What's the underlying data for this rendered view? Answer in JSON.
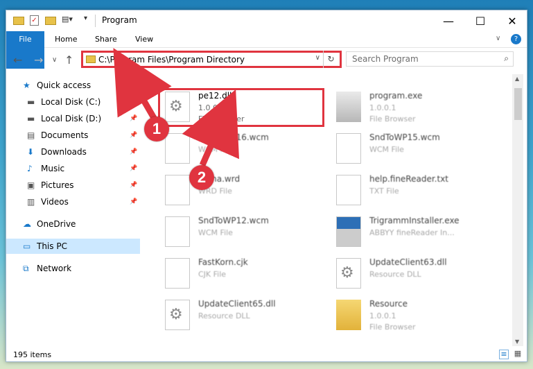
{
  "window": {
    "title": "Program"
  },
  "ribbon": {
    "tabs": [
      "File",
      "Home",
      "Share",
      "View"
    ]
  },
  "address": {
    "path": "C:\\Program Files\\Program Directory"
  },
  "search": {
    "placeholder": "Search Program"
  },
  "sidebar": {
    "items": [
      {
        "label": "Quick access",
        "icon": "star-icon"
      },
      {
        "label": "Local Disk (C:)",
        "icon": "drive-icon",
        "pinned": true
      },
      {
        "label": "Local Disk (D:)",
        "icon": "drive-icon",
        "pinned": true
      },
      {
        "label": "Documents",
        "icon": "documents-icon",
        "pinned": true
      },
      {
        "label": "Downloads",
        "icon": "downloads-icon",
        "pinned": true
      },
      {
        "label": "Music",
        "icon": "music-icon",
        "pinned": true
      },
      {
        "label": "Pictures",
        "icon": "pictures-icon",
        "pinned": true
      },
      {
        "label": "Videos",
        "icon": "videos-icon",
        "pinned": true
      },
      {
        "label": "OneDrive",
        "icon": "cloud-icon"
      },
      {
        "label": "This PC",
        "icon": "computer-icon",
        "selected": true
      },
      {
        "label": "Network",
        "icon": "network-icon"
      }
    ]
  },
  "files": [
    {
      "name": "pe12.dll",
      "version": "1.0.0.1",
      "type": "File Browser",
      "icon": "gear-file-icon"
    },
    {
      "name": "program.exe",
      "version": "1.0.0.1",
      "type": "File Browser",
      "icon": "exe-icon"
    },
    {
      "name": "SndToWP16.wcm",
      "version": "",
      "type": "WCM File",
      "icon": "file-icon"
    },
    {
      "name": "SndToWP15.wcm",
      "version": "",
      "type": "WCM File",
      "icon": "file-icon"
    },
    {
      "name": "Alpha.wrd",
      "version": "",
      "type": "WRD File",
      "icon": "file-icon"
    },
    {
      "name": "help.fineReader.txt",
      "version": "",
      "type": "TXT File",
      "icon": "file-icon"
    },
    {
      "name": "SndToWP12.wcm",
      "version": "",
      "type": "WCM File",
      "icon": "file-icon"
    },
    {
      "name": "TrigrammInstaller.exe",
      "version": "",
      "type": "ABBYY fineReader In...",
      "icon": "installer-icon"
    },
    {
      "name": "FastKorn.cjk",
      "version": "",
      "type": "CJK File",
      "icon": "file-icon"
    },
    {
      "name": "UpdateClient63.dll",
      "version": "",
      "type": "Resource DLL",
      "icon": "gear-file-icon"
    },
    {
      "name": "UpdateClient65.dll",
      "version": "",
      "type": "Resource DLL",
      "icon": "gear-file-icon"
    },
    {
      "name": "Resource",
      "version": "1.0.0.1",
      "type": "File Browser",
      "icon": "folder-zip-icon"
    }
  ],
  "status": {
    "count": "195 items"
  },
  "callouts": [
    "1",
    "2"
  ],
  "colors": {
    "accent": "#1979ca",
    "highlight": "#e0343f"
  }
}
